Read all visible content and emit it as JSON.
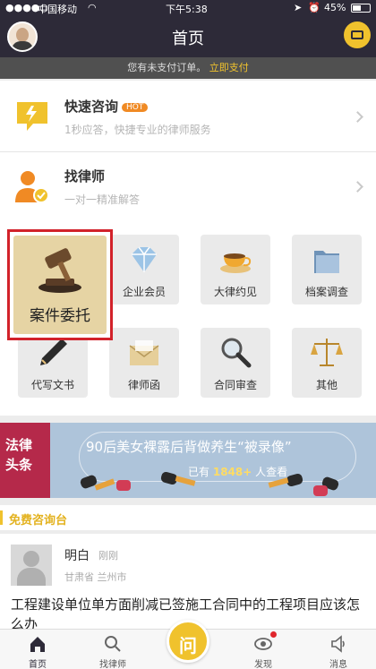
{
  "status_bar": {
    "carrier": "中国移动",
    "time": "下午5:38",
    "battery": "45%"
  },
  "header": {
    "title": "首页"
  },
  "notice": {
    "text": "您有未支付订单。",
    "link": "立即支付"
  },
  "services": [
    {
      "title": "快速咨询",
      "badge": "HOT",
      "subtitle": "1秒应答，快捷专业的律师服务"
    },
    {
      "title": "找律师",
      "subtitle": "一对一精准解答"
    }
  ],
  "grid": [
    {
      "label": "案件委托"
    },
    {
      "label": "企业会员"
    },
    {
      "label": "大律约见"
    },
    {
      "label": "档案调查"
    },
    {
      "label": "代写文书"
    },
    {
      "label": "律师函"
    },
    {
      "label": "合同审查"
    },
    {
      "label": "其他"
    }
  ],
  "banner": {
    "tag_line1": "法律",
    "tag_line2": "头条",
    "headline": "90后美女裸露后背做养生“被录像”",
    "viewers_prefix": "已有",
    "viewers_count": "1848+",
    "viewers_suffix": "人查看"
  },
  "free_consult": {
    "title": "免费咨询台",
    "item": {
      "name": "明白",
      "time": "刚刚",
      "location": "甘肃省 兰州市",
      "question": "工程建设单位单方面削减已签施工合同中的工程项目应该怎么办"
    }
  },
  "tabbar": {
    "home": "首页",
    "find_lawyer": "找律师",
    "ask": "问",
    "discover": "发现",
    "messages": "消息"
  },
  "colors": {
    "accent": "#f0c22d",
    "nav_bg": "#2d2a38",
    "highlight_border": "#d2222a"
  }
}
